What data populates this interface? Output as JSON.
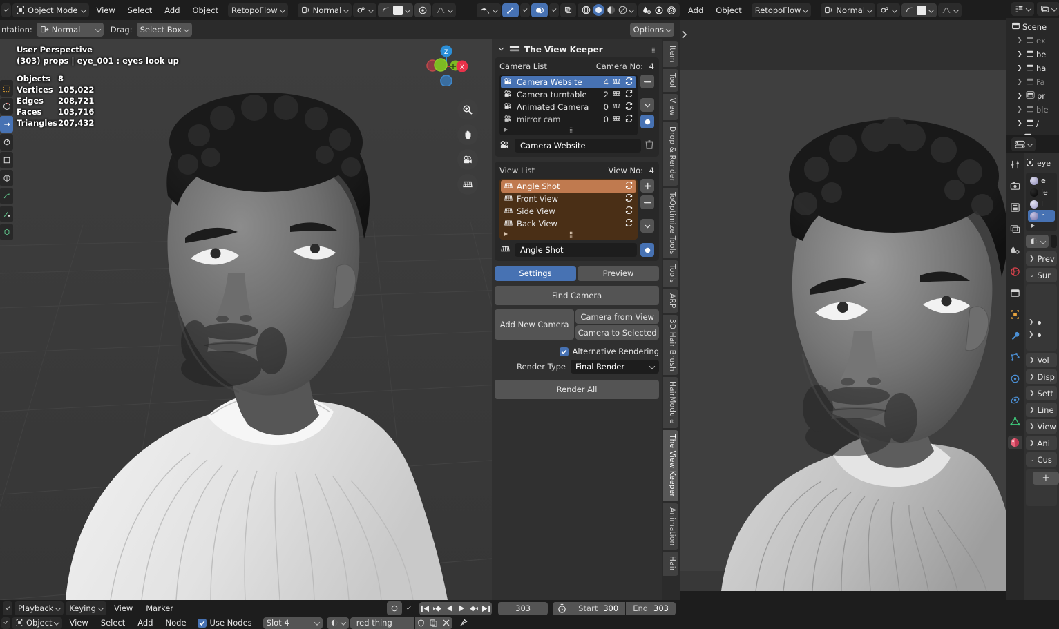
{
  "topbar_left": {
    "mode": "Object Mode",
    "menus": [
      "View",
      "Select",
      "Add",
      "Object"
    ],
    "addon_menu": "RetopoFlow",
    "transform_orientation": "Normal"
  },
  "toolsettings_left": {
    "orientation_label": "ntation:",
    "orientation_value": "Normal",
    "drag_label": "Drag:",
    "drag_value": "Select Box",
    "options_label": "Options"
  },
  "topbar_right": {
    "menus": [
      "Add",
      "Object"
    ],
    "addon_menu": "RetopoFlow",
    "transform_orientation": "Normal"
  },
  "viewport_left": {
    "perspective": "User Perspective",
    "object_line": "(303) props | eye_001 : eyes look up",
    "stats": [
      {
        "label": "Objects",
        "value": "8"
      },
      {
        "label": "Vertices",
        "value": "105,022"
      },
      {
        "label": "Edges",
        "value": "208,721"
      },
      {
        "label": "Faces",
        "value": "103,716"
      },
      {
        "label": "Triangles",
        "value": "207,432"
      }
    ],
    "gizmo_axes": [
      "Z",
      "X"
    ],
    "nav_buttons": [
      "zoom-icon",
      "hand-icon",
      "camera-icon",
      "grid-icon"
    ]
  },
  "view_keeper": {
    "title": "The View Keeper",
    "camera_list": {
      "label": "Camera List",
      "count_label": "Camera No:",
      "count": "4",
      "items": [
        {
          "name": "Camera Website",
          "views": "4",
          "selected": true
        },
        {
          "name": "Camera turntable",
          "views": "2",
          "selected": false
        },
        {
          "name": "Animated Camera",
          "views": "0",
          "selected": false
        },
        {
          "name": "mirror cam",
          "views": "0",
          "selected": false
        }
      ],
      "active_name": "Camera Website"
    },
    "view_list": {
      "label": "View List",
      "count_label": "View No:",
      "count": "4",
      "items": [
        {
          "name": "Angle Shot",
          "selected": true
        },
        {
          "name": "Front View",
          "selected": false
        },
        {
          "name": "Side View",
          "selected": false
        },
        {
          "name": "Back View",
          "selected": false
        }
      ],
      "active_name": "Angle Shot"
    },
    "tabs": [
      {
        "label": "Settings",
        "active": true
      },
      {
        "label": "Preview",
        "active": false
      }
    ],
    "find_camera": "Find Camera",
    "add_new_camera": "Add New Camera",
    "camera_from_view": "Camera from View",
    "camera_to_selected": "Camera to Selected",
    "alternative_rendering": {
      "label": "Alternative Rendering",
      "checked": true
    },
    "render_type": {
      "label": "Render Type",
      "value": "Final Render"
    },
    "render_all": "Render All",
    "accent_blue": "#4772b3",
    "accent_orange": "#c07a4f"
  },
  "npanel_tabs": [
    {
      "label": "Item",
      "active": false
    },
    {
      "label": "Tool",
      "active": false
    },
    {
      "label": "View",
      "active": false
    },
    {
      "label": "Drop & Render",
      "active": false
    },
    {
      "label": "ToOptimize Tools",
      "active": false
    },
    {
      "label": "Tools",
      "active": false
    },
    {
      "label": "ARP",
      "active": false
    },
    {
      "label": "3D Hair Brush",
      "active": false
    },
    {
      "label": "HairModule",
      "active": false
    },
    {
      "label": "The View Keeper",
      "active": true
    },
    {
      "label": "Animation",
      "active": false
    },
    {
      "label": "Hair",
      "active": false
    }
  ],
  "outliner": {
    "scene_label": "Scene",
    "rows": [
      {
        "label": "ex",
        "arrow": true,
        "dim": true
      },
      {
        "label": "be",
        "arrow": true,
        "dim": false
      },
      {
        "label": "ha",
        "arrow": true,
        "dim": false
      },
      {
        "label": "Fa",
        "arrow": true,
        "dim": true
      },
      {
        "label": "pr",
        "arrow": true,
        "dim": false
      },
      {
        "label": "ble",
        "arrow": true,
        "dim": true
      },
      {
        "label": "/",
        "arrow": true,
        "dim": false
      }
    ]
  },
  "properties": {
    "breadcrumb_object": "eye",
    "material_slots": [
      {
        "name": "e",
        "color": "#b6b4d4",
        "selected": false
      },
      {
        "name": "le",
        "color": "#0b0b0b",
        "selected": false
      },
      {
        "name": "i",
        "color": "#c6c4de",
        "selected": false
      },
      {
        "name": "r",
        "color": "#8f8cc0",
        "selected": true
      }
    ],
    "sections": [
      {
        "label": "Prev",
        "open": false
      },
      {
        "label": "Sur",
        "open": true
      },
      {
        "label": "Vol",
        "open": false
      },
      {
        "label": "Disp",
        "open": false
      },
      {
        "label": "Sett",
        "open": false
      },
      {
        "label": "Line",
        "open": false
      },
      {
        "label": "View",
        "open": false
      },
      {
        "label": "Ani",
        "open": false
      },
      {
        "label": "Cus",
        "open": true
      }
    ],
    "add_button": "+",
    "tab_icons": [
      "tool-icon",
      "render-icon",
      "output-icon",
      "viewlayer-icon",
      "scene-icon",
      "world-icon",
      "collection-icon",
      "object-icon",
      "modifier-icon",
      "particles-icon",
      "physics-icon",
      "constraint-icon",
      "data-icon",
      "material-icon"
    ],
    "active_tab": "material-icon"
  },
  "timeline": {
    "menus": [
      "Playback",
      "Keying",
      "View",
      "Marker"
    ],
    "current_frame": "303",
    "start_label": "Start",
    "start_value": "300",
    "end_label": "End",
    "end_value": "303",
    "transport": [
      "jump-start-icon",
      "prev-key-icon",
      "play-reverse-icon",
      "play-icon",
      "next-key-icon",
      "jump-end-icon"
    ]
  },
  "node_editor_bar": {
    "mode": "Object",
    "menus": [
      "View",
      "Select",
      "Add",
      "Node"
    ],
    "use_nodes": {
      "label": "Use Nodes",
      "checked": true
    },
    "slot": "Slot 4",
    "material": "red thing"
  }
}
